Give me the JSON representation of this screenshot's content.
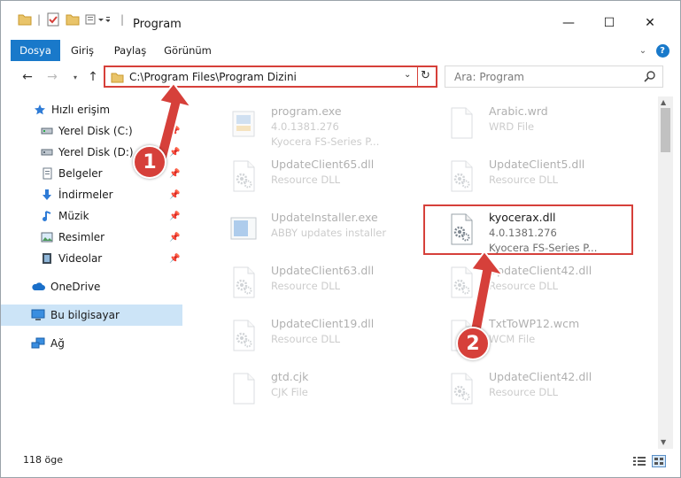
{
  "window": {
    "title": "Program",
    "controls": {
      "minimize": "—",
      "maximize": "☐",
      "close": "✕"
    }
  },
  "ribbon": {
    "tabs": [
      "Dosya",
      "Giriş",
      "Paylaş",
      "Görünüm"
    ],
    "active_tab": "Dosya",
    "collapse_icon": "chevron-down-icon",
    "help_label": "?"
  },
  "address_bar": {
    "path": "C:\\Program Files\\Program Dizini",
    "search_placeholder": "Ara: Program"
  },
  "sidebar": {
    "items": [
      {
        "label": "Hızlı erişim",
        "icon": "star-icon"
      },
      {
        "label": "Yerel Disk (C:)",
        "icon": "drive-icon",
        "pinned": true
      },
      {
        "label": "Yerel Disk (D:)",
        "icon": "drive-icon",
        "pinned": true
      },
      {
        "label": "Belgeler",
        "icon": "documents-icon",
        "pinned": true
      },
      {
        "label": "İndirmeler",
        "icon": "download-icon",
        "pinned": true
      },
      {
        "label": "Müzik",
        "icon": "music-icon",
        "pinned": true
      },
      {
        "label": "Resimler",
        "icon": "pictures-icon",
        "pinned": true
      },
      {
        "label": "Videolar",
        "icon": "videos-icon",
        "pinned": true
      },
      {
        "label": "OneDrive",
        "icon": "cloud-icon"
      },
      {
        "label": "Bu bilgisayar",
        "icon": "computer-icon",
        "selected": true
      },
      {
        "label": "Ağ",
        "icon": "network-icon"
      }
    ]
  },
  "files": [
    {
      "name": "program.exe",
      "line2": "4.0.1381.276",
      "line3": "Kyocera FS-Series P...",
      "icon": "exe-icon",
      "faded": true
    },
    {
      "name": "Arabic.wrd",
      "line2": "WRD File",
      "line3": "",
      "icon": "blank-file-icon",
      "faded": true
    },
    {
      "name": "UpdateClient65.dll",
      "line2": "Resource DLL",
      "line3": "",
      "icon": "dll-gear-icon",
      "faded": true
    },
    {
      "name": "UpdateClient5.dll",
      "line2": "Resource DLL",
      "line3": "",
      "icon": "dll-gear-icon",
      "faded": true
    },
    {
      "name": "UpdateInstaller.exe",
      "line2": "ABBY updates installer",
      "line3": "",
      "icon": "installer-icon",
      "faded": true
    },
    {
      "name": "kyocerax.dll",
      "line2": "4.0.1381.276",
      "line3": "Kyocera FS-Series P...",
      "icon": "dll-gear-icon",
      "faded": false
    },
    {
      "name": "UpdateClient63.dll",
      "line2": "Resource DLL",
      "line3": "",
      "icon": "dll-gear-icon",
      "faded": true
    },
    {
      "name": "UpdateClient42.dll",
      "line2": "Resource DLL",
      "line3": "",
      "icon": "dll-gear-icon",
      "faded": true
    },
    {
      "name": "UpdateClient19.dll",
      "line2": "Resource DLL",
      "line3": "",
      "icon": "dll-gear-icon",
      "faded": true
    },
    {
      "name": "TxtToWP12.wcm",
      "line2": "WCM File",
      "line3": "",
      "icon": "blank-file-icon",
      "faded": true
    },
    {
      "name": "gtd.cjk",
      "line2": "CJK File",
      "line3": "",
      "icon": "blank-file-icon",
      "faded": true
    },
    {
      "name": "UpdateClient42.dll",
      "line2": "Resource DLL",
      "line3": "",
      "icon": "dll-gear-icon",
      "faded": true
    }
  ],
  "status_bar": {
    "item_count": "118 öge"
  },
  "annotations": {
    "marker1": "1",
    "marker2": "2",
    "highlight_color": "#d6403a"
  },
  "colors": {
    "accent": "#1979ca",
    "selection": "#cce4f7",
    "annotation": "#d6403a"
  }
}
